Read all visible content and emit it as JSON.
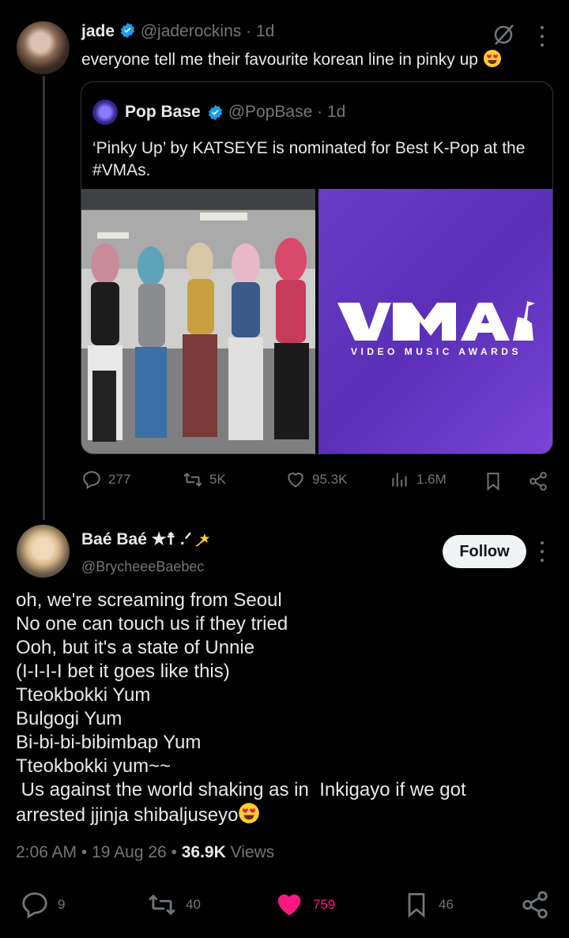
{
  "tweet1": {
    "name": "jade",
    "handle": "@jaderockins",
    "time": "1d",
    "text": "everyone tell me their favourite korean line in pinky up",
    "quote": {
      "name": "Pop Base",
      "handle": "@PopBase",
      "time": "1d",
      "text": "‘Pinky Up’ by KATSEYE is nominated for Best K-Pop at the #VMAs.",
      "vma_subtitle": "VIDEO MUSIC AWARDS"
    },
    "actions": {
      "replies": "277",
      "reposts": "5K",
      "likes": "95.3K",
      "views": "1.6M"
    }
  },
  "tweet2": {
    "name": "Baé Baé ★☨ .ᐟ",
    "handle": "@BrycheeeBaebec",
    "follow_label": "Follow",
    "lines": [
      "oh, we're screaming from Seoul",
      "No one can touch us if they tried",
      "Ooh, but it's a state of Unnie",
      "(I-I-I-I bet it goes like this)",
      "Tteokbokki Yum",
      "Bulgogi Yum",
      "Bi-bi-bi-bibimbap Yum",
      "Tteokbokki yum~~",
      " Us against the world shaking as in  Inkigayo if we got",
      "arrested jjinja shibaljuseyo"
    ],
    "time": "2:06 AM",
    "date": "19 Aug 26",
    "views_count": "36.9K",
    "views_label": "Views",
    "actions": {
      "replies": "9",
      "reposts": "40",
      "likes": "759",
      "bookmarks": "46"
    }
  },
  "colors": {
    "accent_like": "#f91880",
    "verified": "#1d9bf0",
    "muted": "#71767b"
  }
}
